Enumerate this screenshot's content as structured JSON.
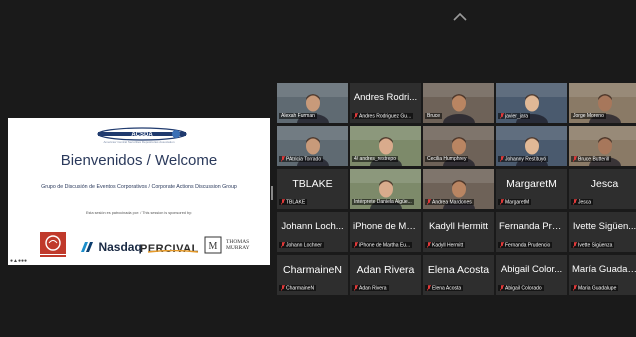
{
  "share": {
    "logo_text": "ACSDA",
    "logo_sub": "Americas' Central Securities Depositories Association",
    "welcome": "Bienvenidos / Welcome",
    "subtitle": "Grupo de Discusión de Eventos Corporativos / Corporate Actions Discussion Group",
    "sponsored": "Esta sesión es patrocinada por: / This session is sponsored by:",
    "sponsors": [
      "Nasdaq",
      "PERCIVAL",
      "THOMAS MURRAY"
    ],
    "dots": "●▲●●●"
  },
  "participants": [
    {
      "big": "",
      "name": "Alexah Furman",
      "video": true,
      "active": true,
      "mic_muted": false
    },
    {
      "big": "Andres Rodri...",
      "name": "Andres Rodriguez Gu...",
      "video": false,
      "mic_muted": true
    },
    {
      "big": "",
      "name": "Bruce",
      "video": true,
      "mic_muted": false
    },
    {
      "big": "",
      "name": "javier_jara",
      "video": true,
      "mic_muted": true
    },
    {
      "big": "",
      "name": "Jorge Moreno",
      "video": true,
      "mic_muted": false
    },
    {
      "big": "",
      "name": "PAtricia Torrado",
      "video": true,
      "mic_muted": true
    },
    {
      "big": "",
      "name": "4/ andres_restrepo",
      "video": true,
      "mic_muted": false
    },
    {
      "big": "",
      "name": "Cecilia Humphrey",
      "video": true,
      "mic_muted": false
    },
    {
      "big": "",
      "name": "Johanny Restituyó",
      "video": true,
      "mic_muted": true
    },
    {
      "big": "",
      "name": "Bruce Butterill",
      "video": true,
      "mic_muted": true
    },
    {
      "big": "TBLAKE",
      "name": "TBLAKE",
      "video": false,
      "mic_muted": true
    },
    {
      "big": "",
      "name": "Intérprete Daniela Algüe...",
      "video": true,
      "mic_muted": false
    },
    {
      "big": "",
      "name": "Andrea Mardones",
      "video": true,
      "mic_muted": true
    },
    {
      "big": "MargaretM",
      "name": "MargaretM",
      "video": false,
      "mic_muted": true
    },
    {
      "big": "Jesca",
      "name": "Jesca",
      "video": false,
      "mic_muted": true
    },
    {
      "big": "Johann Loch...",
      "name": "Johann Lochner",
      "video": false,
      "mic_muted": true
    },
    {
      "big": "iPhone de Ma...",
      "name": "iPhone de Martha Eu...",
      "video": false,
      "mic_muted": true
    },
    {
      "big": "Kadyll Hermitt",
      "name": "Kadyll Hermitt",
      "video": false,
      "mic_muted": true
    },
    {
      "big": "Fernanda Pru...",
      "name": "Fernanda Prudencio",
      "video": false,
      "mic_muted": true
    },
    {
      "big": "Ivette Sigüen...",
      "name": "Ivette Sigüenza",
      "video": false,
      "mic_muted": true
    },
    {
      "big": "CharmaineN",
      "name": "CharmaineN",
      "video": false,
      "mic_muted": true
    },
    {
      "big": "Adan Rivera",
      "name": "Adan Rivera",
      "video": false,
      "mic_muted": true
    },
    {
      "big": "Elena Acosta",
      "name": "Elena Acosta",
      "video": false,
      "mic_muted": true
    },
    {
      "big": "Abigail Color...",
      "name": "Abigail Colorado",
      "video": false,
      "mic_muted": true
    },
    {
      "big": "María Guadal...",
      "name": "Maria Guadalupe",
      "video": false,
      "mic_muted": true
    }
  ]
}
